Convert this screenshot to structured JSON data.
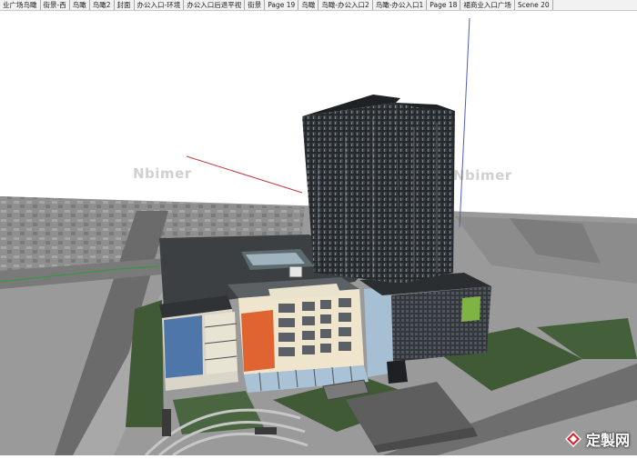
{
  "scene_tabs": [
    "业广场鸟瞰",
    "街景-西",
    "鸟瞰",
    "鸟瞰2",
    "封面",
    "办公入口-环境",
    "办公入口后退平视",
    "街景",
    "Page 19",
    "鸟瞰",
    "鸟瞰-办公入口2",
    "鸟瞰-办公入口1",
    "Page 18",
    "裙商业入口广场",
    "Scene 20"
  ],
  "watermarks": {
    "left": "Nbimer",
    "right": "Nbimer"
  },
  "site_logo": {
    "text": "定製网"
  },
  "colors": {
    "ground": "#9a9a9a",
    "lawn": "#3f5a34",
    "tower": "#26292c",
    "panel_blue": "#4f76a8",
    "panel_orange": "#e06432",
    "facade_cream": "#efe5cc",
    "glass": "#aac2d6",
    "axis_red": "#c23b3b",
    "axis_green": "#2f9a3a",
    "axis_blue": "#4d5bc4"
  }
}
